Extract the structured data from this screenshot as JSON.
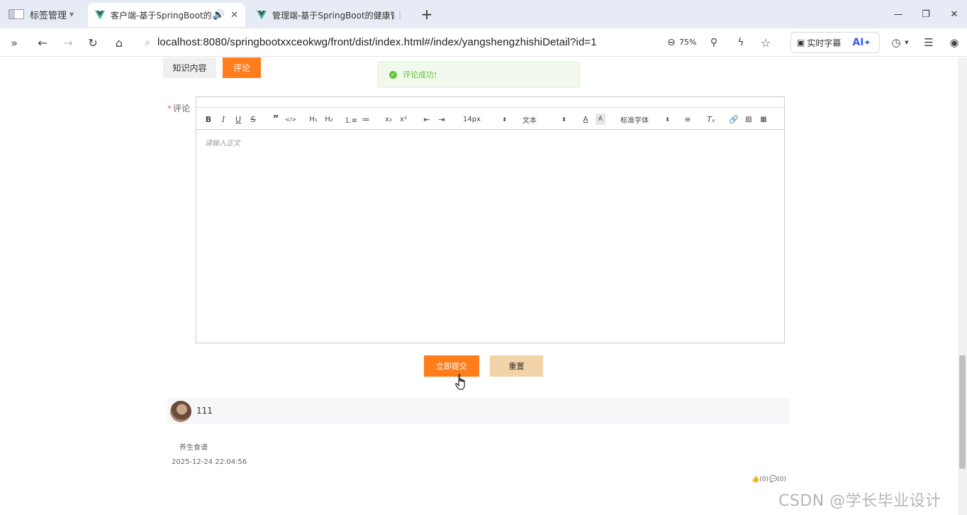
{
  "browser": {
    "tab_group_label": "标签管理",
    "tabs": [
      {
        "title": "客户端-基于SpringBoot的",
        "active": true
      },
      {
        "title": "管理端-基于SpringBoot的健康管",
        "active": false
      }
    ],
    "new_tab_icon": "plus-icon",
    "url": "localhost:8080/springbootxxceokwg/front/dist/index.html#/index/yangshengzhishiDetail?id=1",
    "zoom": "75%",
    "caption_label": "实时字幕",
    "ai_label": "AI"
  },
  "page": {
    "tabs": [
      {
        "label": "知识内容",
        "active": false
      },
      {
        "label": "评论",
        "active": true
      }
    ],
    "toast": {
      "message": "评论成功!",
      "type": "success"
    },
    "form": {
      "comment_label": "评论",
      "required_mark": "*",
      "editor": {
        "placeholder": "请输入正文",
        "font_size": "14px",
        "paragraph": "文本",
        "font_family": "标准字体",
        "toolbar_icons": [
          "bold-icon",
          "italic-icon",
          "underline-icon",
          "strike-icon",
          "blockquote-icon",
          "code-block-icon",
          "h1-icon",
          "h2-icon",
          "ordered-list-icon",
          "bullet-list-icon",
          "subscript-icon",
          "superscript-icon",
          "outdent-icon",
          "indent-icon",
          "font-color-icon",
          "background-color-icon",
          "align-icon",
          "clear-format-icon",
          "link-icon",
          "image-icon",
          "video-icon"
        ]
      },
      "submit_label": "立即提交",
      "reset_label": "重置"
    },
    "comments": [
      {
        "text": "111",
        "category": "养生食谱",
        "timestamp": "2025-12-24 22:04:56",
        "likes": "(0)",
        "replies": "(0)"
      }
    ]
  },
  "watermark": "CSDN @学长毕业设计",
  "colors": {
    "accent": "#ff7d1a",
    "reset_button": "#f3d3a8",
    "success": "#67c23a",
    "toast_bg": "#f0f9eb"
  }
}
